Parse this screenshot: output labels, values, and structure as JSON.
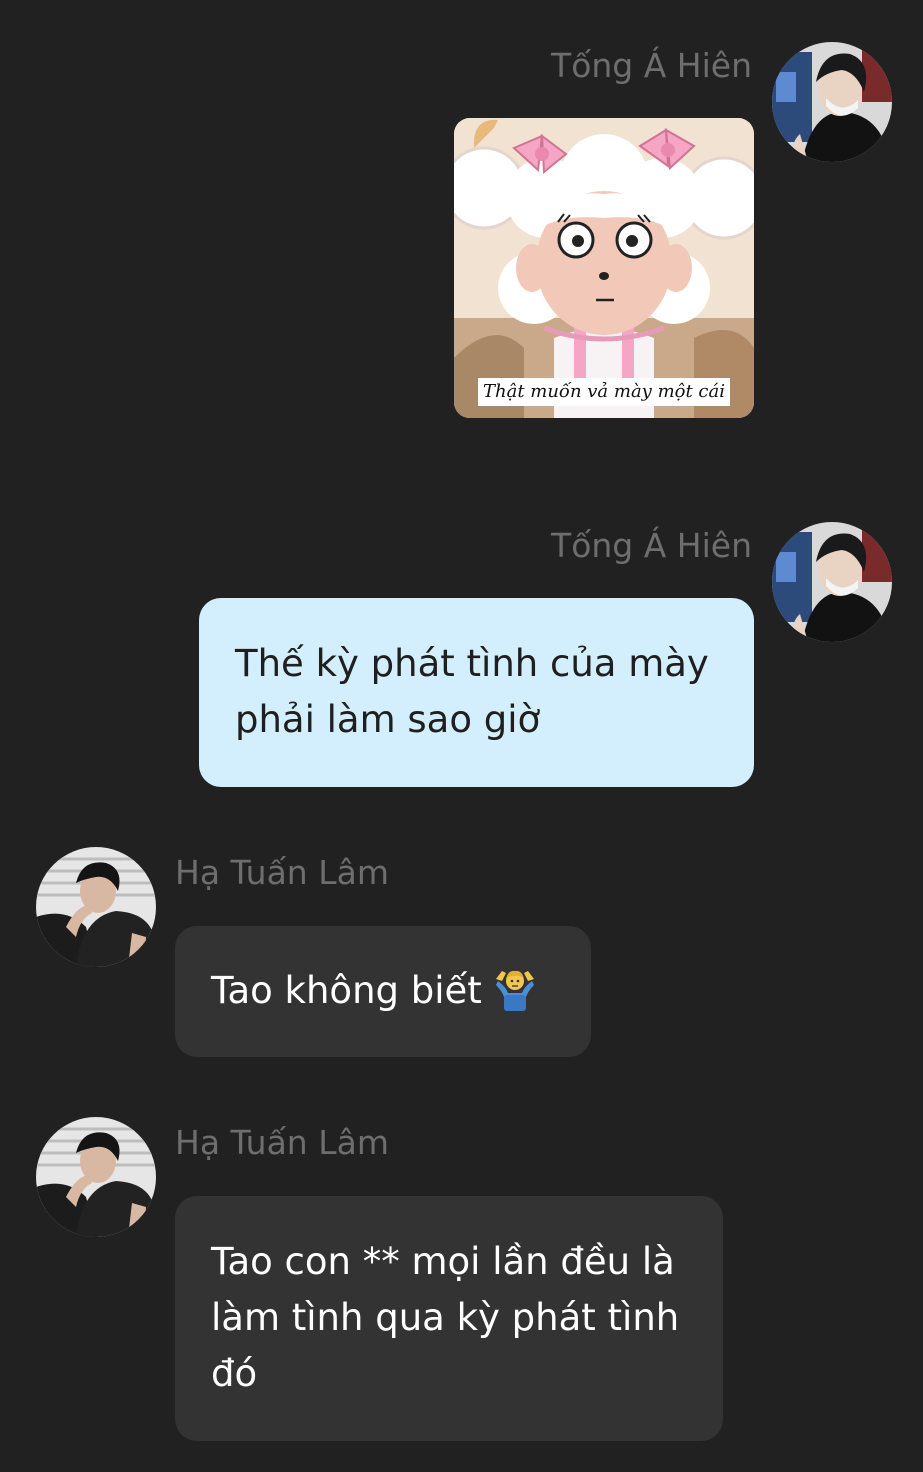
{
  "messages": [
    {
      "sender": "Tống Á Hiên",
      "direction": "outgoing",
      "type": "sticker",
      "sticker_caption": "Thật muốn vả mày một cái",
      "avatar_icon": "avatar-tong-a-hien"
    },
    {
      "sender": "Tống Á Hiên",
      "direction": "outgoing",
      "type": "text",
      "lines": [
        "Thế kỳ phát tình của mày",
        "phải làm sao giờ"
      ],
      "avatar_icon": "avatar-tong-a-hien"
    },
    {
      "sender": "Hạ Tuấn Lâm",
      "direction": "incoming",
      "type": "text",
      "text": "Tao không biết",
      "emoji": "man-shrugging-icon",
      "avatar_icon": "avatar-ha-tuan-lam"
    },
    {
      "sender": "Hạ Tuấn Lâm",
      "direction": "incoming",
      "type": "text",
      "lines": [
        "Tao con ** mọi lần đều là",
        "làm tình qua kỳ phát tình",
        "đó"
      ],
      "avatar_icon": "avatar-ha-tuan-lam"
    }
  ],
  "colors": {
    "background": "#212121",
    "outgoing_bubble": "#d3effd",
    "incoming_bubble": "#333333",
    "name_text": "#6e6e6e"
  }
}
